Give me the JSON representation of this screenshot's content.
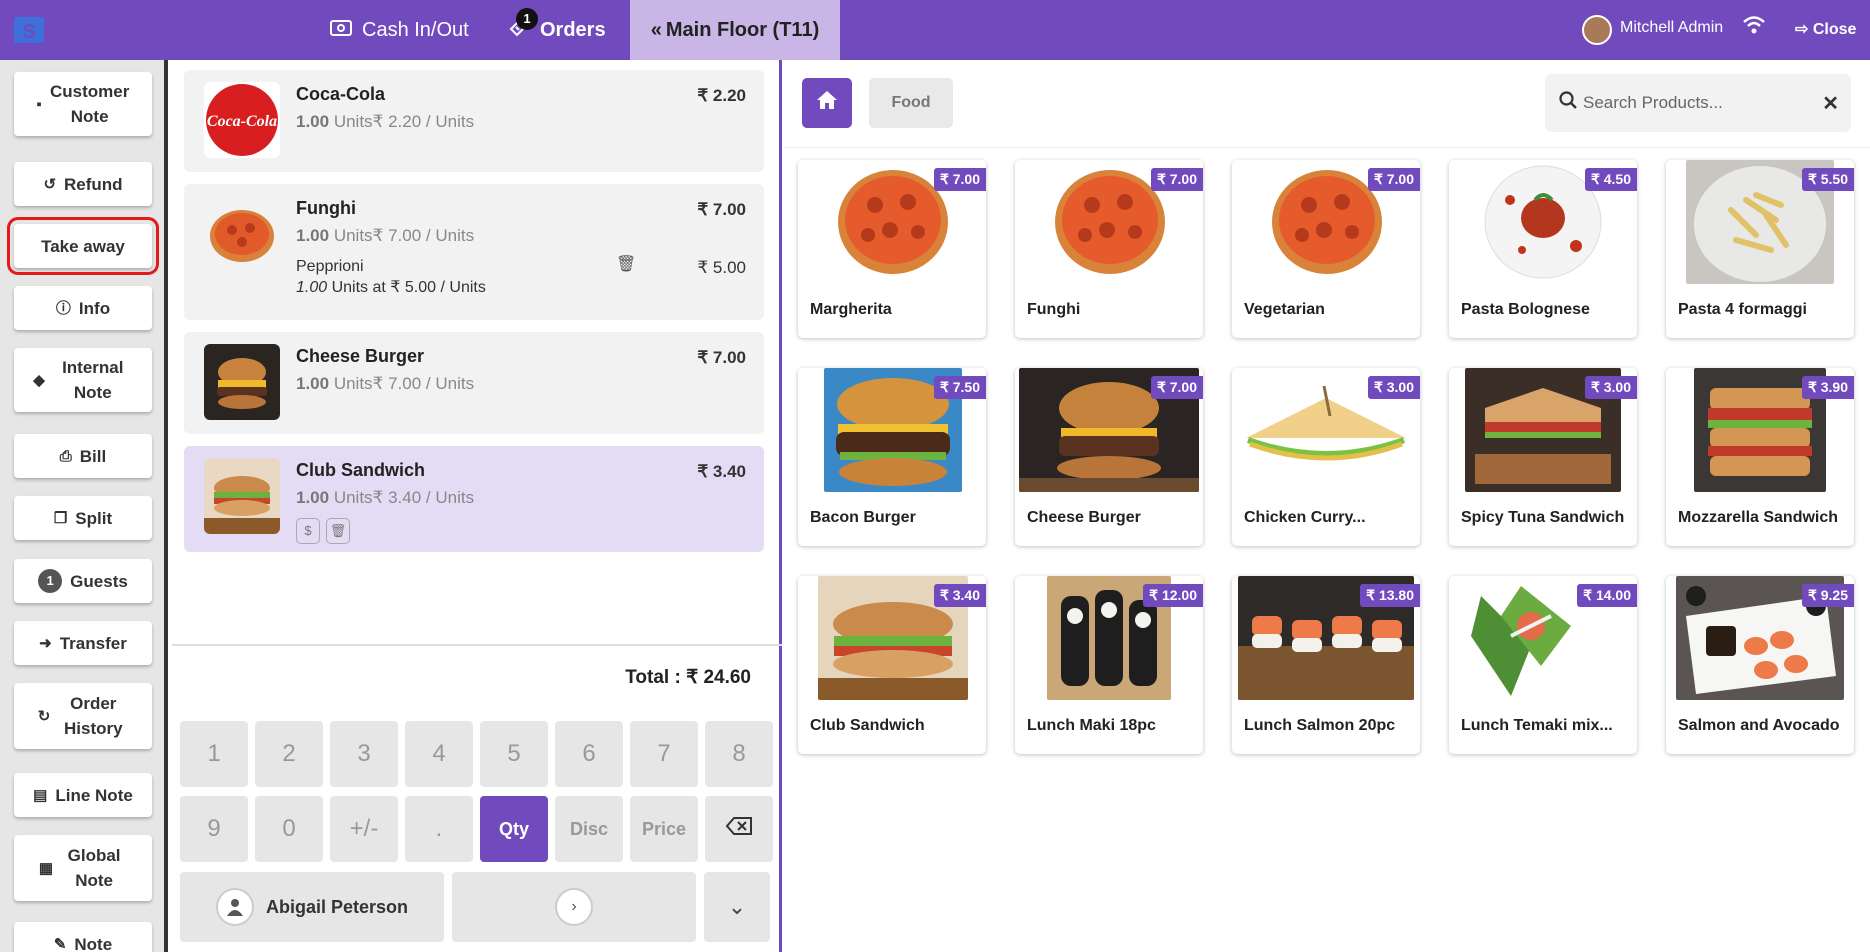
{
  "topbar": {
    "cash_label": "Cash In/Out",
    "orders_label": "Orders",
    "orders_badge": "1",
    "floor_label": "Main Floor (T11)",
    "user_name": "Mitchell Admin",
    "close_label": "Close"
  },
  "actions": {
    "customer_note": "Customer Note",
    "refund": "Refund",
    "take_away": "Take away",
    "info": "Info",
    "internal_note": "Internal Note",
    "bill": "Bill",
    "split": "Split",
    "guests_count": "1",
    "guests": "Guests",
    "transfer": "Transfer",
    "order_history": "Order History",
    "line_note": "Line Note",
    "global_note": "Global Note",
    "note": "Note"
  },
  "order": {
    "lines": [
      {
        "name": "Coca-Cola",
        "qty": "1.00",
        "unit_price": "Units₹ 2.20 / Units",
        "price": "₹ 2.20"
      },
      {
        "name": "Funghi",
        "qty": "1.00",
        "unit_price": "Units₹ 7.00 / Units",
        "price": "₹ 7.00",
        "topping_name": "Pepprioni",
        "topping_qty": "1.00",
        "topping_desc": "Units at ₹ 5.00 / Units",
        "topping_price": "₹ 5.00"
      },
      {
        "name": "Cheese Burger",
        "qty": "1.00",
        "unit_price": "Units₹ 7.00 / Units",
        "price": "₹ 7.00"
      },
      {
        "name": "Club Sandwich",
        "qty": "1.00",
        "unit_price": "Units₹ 3.40 / Units",
        "price": "₹ 3.40"
      }
    ],
    "total": "Total : ₹ 24.60"
  },
  "numpad": {
    "row1": [
      "1",
      "2",
      "3",
      "4",
      "5",
      "6",
      "7",
      "8"
    ],
    "row2": [
      "9",
      "0",
      "+/-",
      ".",
      "Qty",
      "Disc",
      "Price"
    ],
    "customer": "Abigail Peterson"
  },
  "categories": {
    "food": "Food"
  },
  "search": {
    "placeholder": "Search Products..."
  },
  "products": [
    {
      "name": "Margherita",
      "price": "₹ 7.00"
    },
    {
      "name": "Funghi",
      "price": "₹ 7.00"
    },
    {
      "name": "Vegetarian",
      "price": "₹ 7.00"
    },
    {
      "name": "Pasta Bolognese",
      "price": "₹ 4.50"
    },
    {
      "name": "Pasta 4 formaggi",
      "price": "₹ 5.50"
    },
    {
      "name": "Bacon Burger",
      "price": "₹ 7.50"
    },
    {
      "name": "Cheese Burger",
      "price": "₹ 7.00"
    },
    {
      "name": "Chicken Curry...",
      "price": "₹ 3.00"
    },
    {
      "name": "Spicy Tuna Sandwich",
      "price": "₹ 3.00"
    },
    {
      "name": "Mozzarella Sandwich",
      "price": "₹ 3.90"
    },
    {
      "name": "Club Sandwich",
      "price": "₹ 3.40"
    },
    {
      "name": "Lunch Maki 18pc",
      "price": "₹ 12.00"
    },
    {
      "name": "Lunch Salmon 20pc",
      "price": "₹ 13.80"
    },
    {
      "name": "Lunch Temaki mix...",
      "price": "₹ 14.00"
    },
    {
      "name": "Salmon and Avocado",
      "price": "₹ 9.25"
    }
  ],
  "colors": {
    "brand": "#714bbd",
    "highlight": "#e01b1b",
    "selected_line": "#e4dcf4"
  }
}
